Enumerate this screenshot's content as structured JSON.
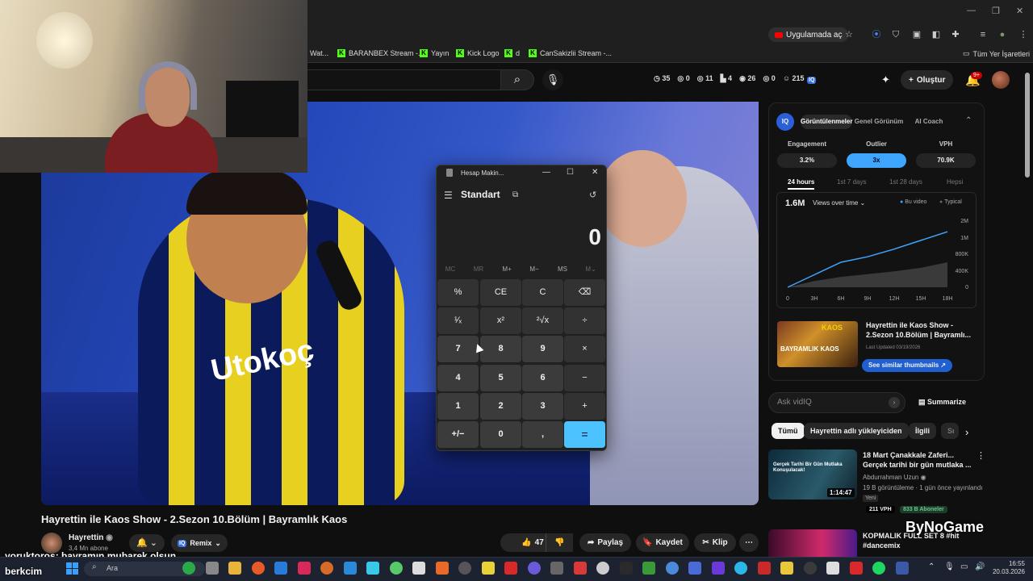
{
  "browser": {
    "app_open_label": "Uygulamada aç",
    "all_bookmarks": "Tüm Yer İşaretleri",
    "bookmarks": [
      "Wat...",
      "BARANBEX Stream -...",
      "Yayın",
      "Kick Logo",
      "d",
      "CanSakizlii Stream -..."
    ]
  },
  "header": {
    "stats": [
      "35",
      "0",
      "11",
      "4",
      "26",
      "0",
      "215"
    ],
    "create_label": "Oluştur",
    "notif_count": "9+"
  },
  "video": {
    "title": "Hayrettin ile Kaos Show - 2.Sezon 10.Bölüm | Bayramlık Kaos",
    "sponsor_text": "Utokoç",
    "channel_name": "Hayrettin",
    "subscribers": "3,4 Mn abone",
    "remix_label": "Remix",
    "likes": "47 B",
    "share_label": "Paylaş",
    "save_label": "Kaydet",
    "clip_label": "Klip"
  },
  "vidiq": {
    "tabs": [
      "Görüntülenmeler",
      "Genel Görünüm",
      "AI Coach"
    ],
    "metrics": [
      {
        "label": "Engagement",
        "value": "3.2%"
      },
      {
        "label": "Outlier",
        "value": "3x"
      },
      {
        "label": "VPH",
        "value": "70.9K"
      }
    ],
    "ranges": [
      "24 hours",
      "1st 7 days",
      "1st 28 days",
      "Hepsi"
    ],
    "views_total": "1.6M",
    "views_select": "Views over time",
    "legend": [
      "Bu video",
      "Typical"
    ],
    "video_title": "Hayrettin ile Kaos Show - 2.Sezon 10.Bölüm | Bayramlı...",
    "last_updated": "Last Updated 03/19/2026",
    "see_similar": "See similar thumbnails",
    "thumb_text": "BAYRAMLIK KAOS",
    "thumb_brand": "KAOS",
    "ask_placeholder": "Ask vidIQ",
    "summarize": "Summarize",
    "logo": "IQ"
  },
  "chart_data": {
    "type": "line",
    "x": [
      "0",
      "3H",
      "6H",
      "9H",
      "12H",
      "15H",
      "18H"
    ],
    "yticks": [
      "0",
      "400K",
      "800K",
      "1M",
      "2M"
    ],
    "series": [
      {
        "name": "Bu video",
        "values": [
          0,
          360000,
          720000,
          880000,
          1100000,
          1350000,
          1600000
        ]
      },
      {
        "name": "Typical",
        "values": [
          0,
          180000,
          300000,
          380000,
          460000,
          560000,
          720000
        ]
      }
    ]
  },
  "chips": [
    "Tümü",
    "Hayrettin adlı yükleyiciden",
    "İlgili",
    "Sı"
  ],
  "recommendations": [
    {
      "title": "18 Mart Çanakkale Zaferi... Gerçek tarihi bir gün mutlaka ...",
      "channel": "Abdurrahman Uzun",
      "meta": "19 B görüntüleme · 1 gün önce yayınlandı",
      "badge": "Yeni",
      "duration": "1:14:47",
      "vph": "211 VPH",
      "subs": "833 B Aboneler",
      "thumb_text": "Gerçek Tarihi Bir Gün Mutlaka Konuşulacak!"
    },
    {
      "title": "KOPMALIK FULL SET 8 #hit #dancemix"
    }
  ],
  "watermark": "ByNoGame",
  "calculator": {
    "title": "Hesap Makin...",
    "mode": "Standart",
    "display": "0",
    "memory": [
      "MC",
      "MR",
      "M+",
      "M−",
      "MS",
      "M⌄"
    ],
    "keys": [
      [
        "%",
        "CE",
        "C",
        "⌫"
      ],
      [
        "¹⁄ₓ",
        "x²",
        "²√x",
        "÷"
      ],
      [
        "7",
        "8",
        "9",
        "×"
      ],
      [
        "4",
        "5",
        "6",
        "−"
      ],
      [
        "1",
        "2",
        "3",
        "+"
      ],
      [
        "+/−",
        "0",
        ",",
        "="
      ]
    ]
  },
  "chat": {
    "user": "yoruktoros",
    "message": ": bayramın mubarek olsun",
    "streamer": "berkcim"
  },
  "taskbar": {
    "search": "Ara",
    "time": "16:55",
    "date": "20.03.2026"
  }
}
